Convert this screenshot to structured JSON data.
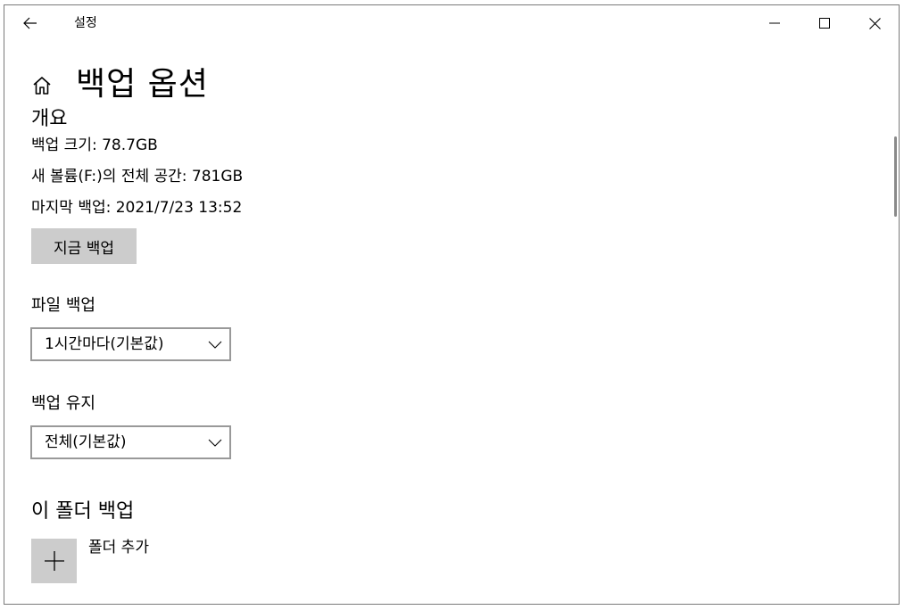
{
  "window": {
    "title": "설정",
    "icons": {
      "back": "arrow-left-icon",
      "minimize": "minimize-icon",
      "maximize": "maximize-icon",
      "close": "close-icon"
    }
  },
  "page": {
    "home_icon": "home-icon",
    "title": "백업 옵션"
  },
  "overview": {
    "heading": "개요",
    "backup_size": "백업 크기: 78.7GB",
    "total_space": "새 볼륨(F:)의 전체 공간: 781GB",
    "last_backup": "마지막 백업: 2021/7/23 13:52",
    "backup_now_label": "지금 백업"
  },
  "file_backup": {
    "label": "파일 백업",
    "selected": "1시간마다(기본값)"
  },
  "keep_backups": {
    "label": "백업 유지",
    "selected": "전체(기본값)"
  },
  "folders": {
    "heading": "이 폴더 백업",
    "add_icon": "plus-icon",
    "add_label": "폴더 추가"
  },
  "colors": {
    "button_gray": "#cccccc",
    "dropdown_border": "#999999",
    "window_border": "#7a7a7a"
  }
}
